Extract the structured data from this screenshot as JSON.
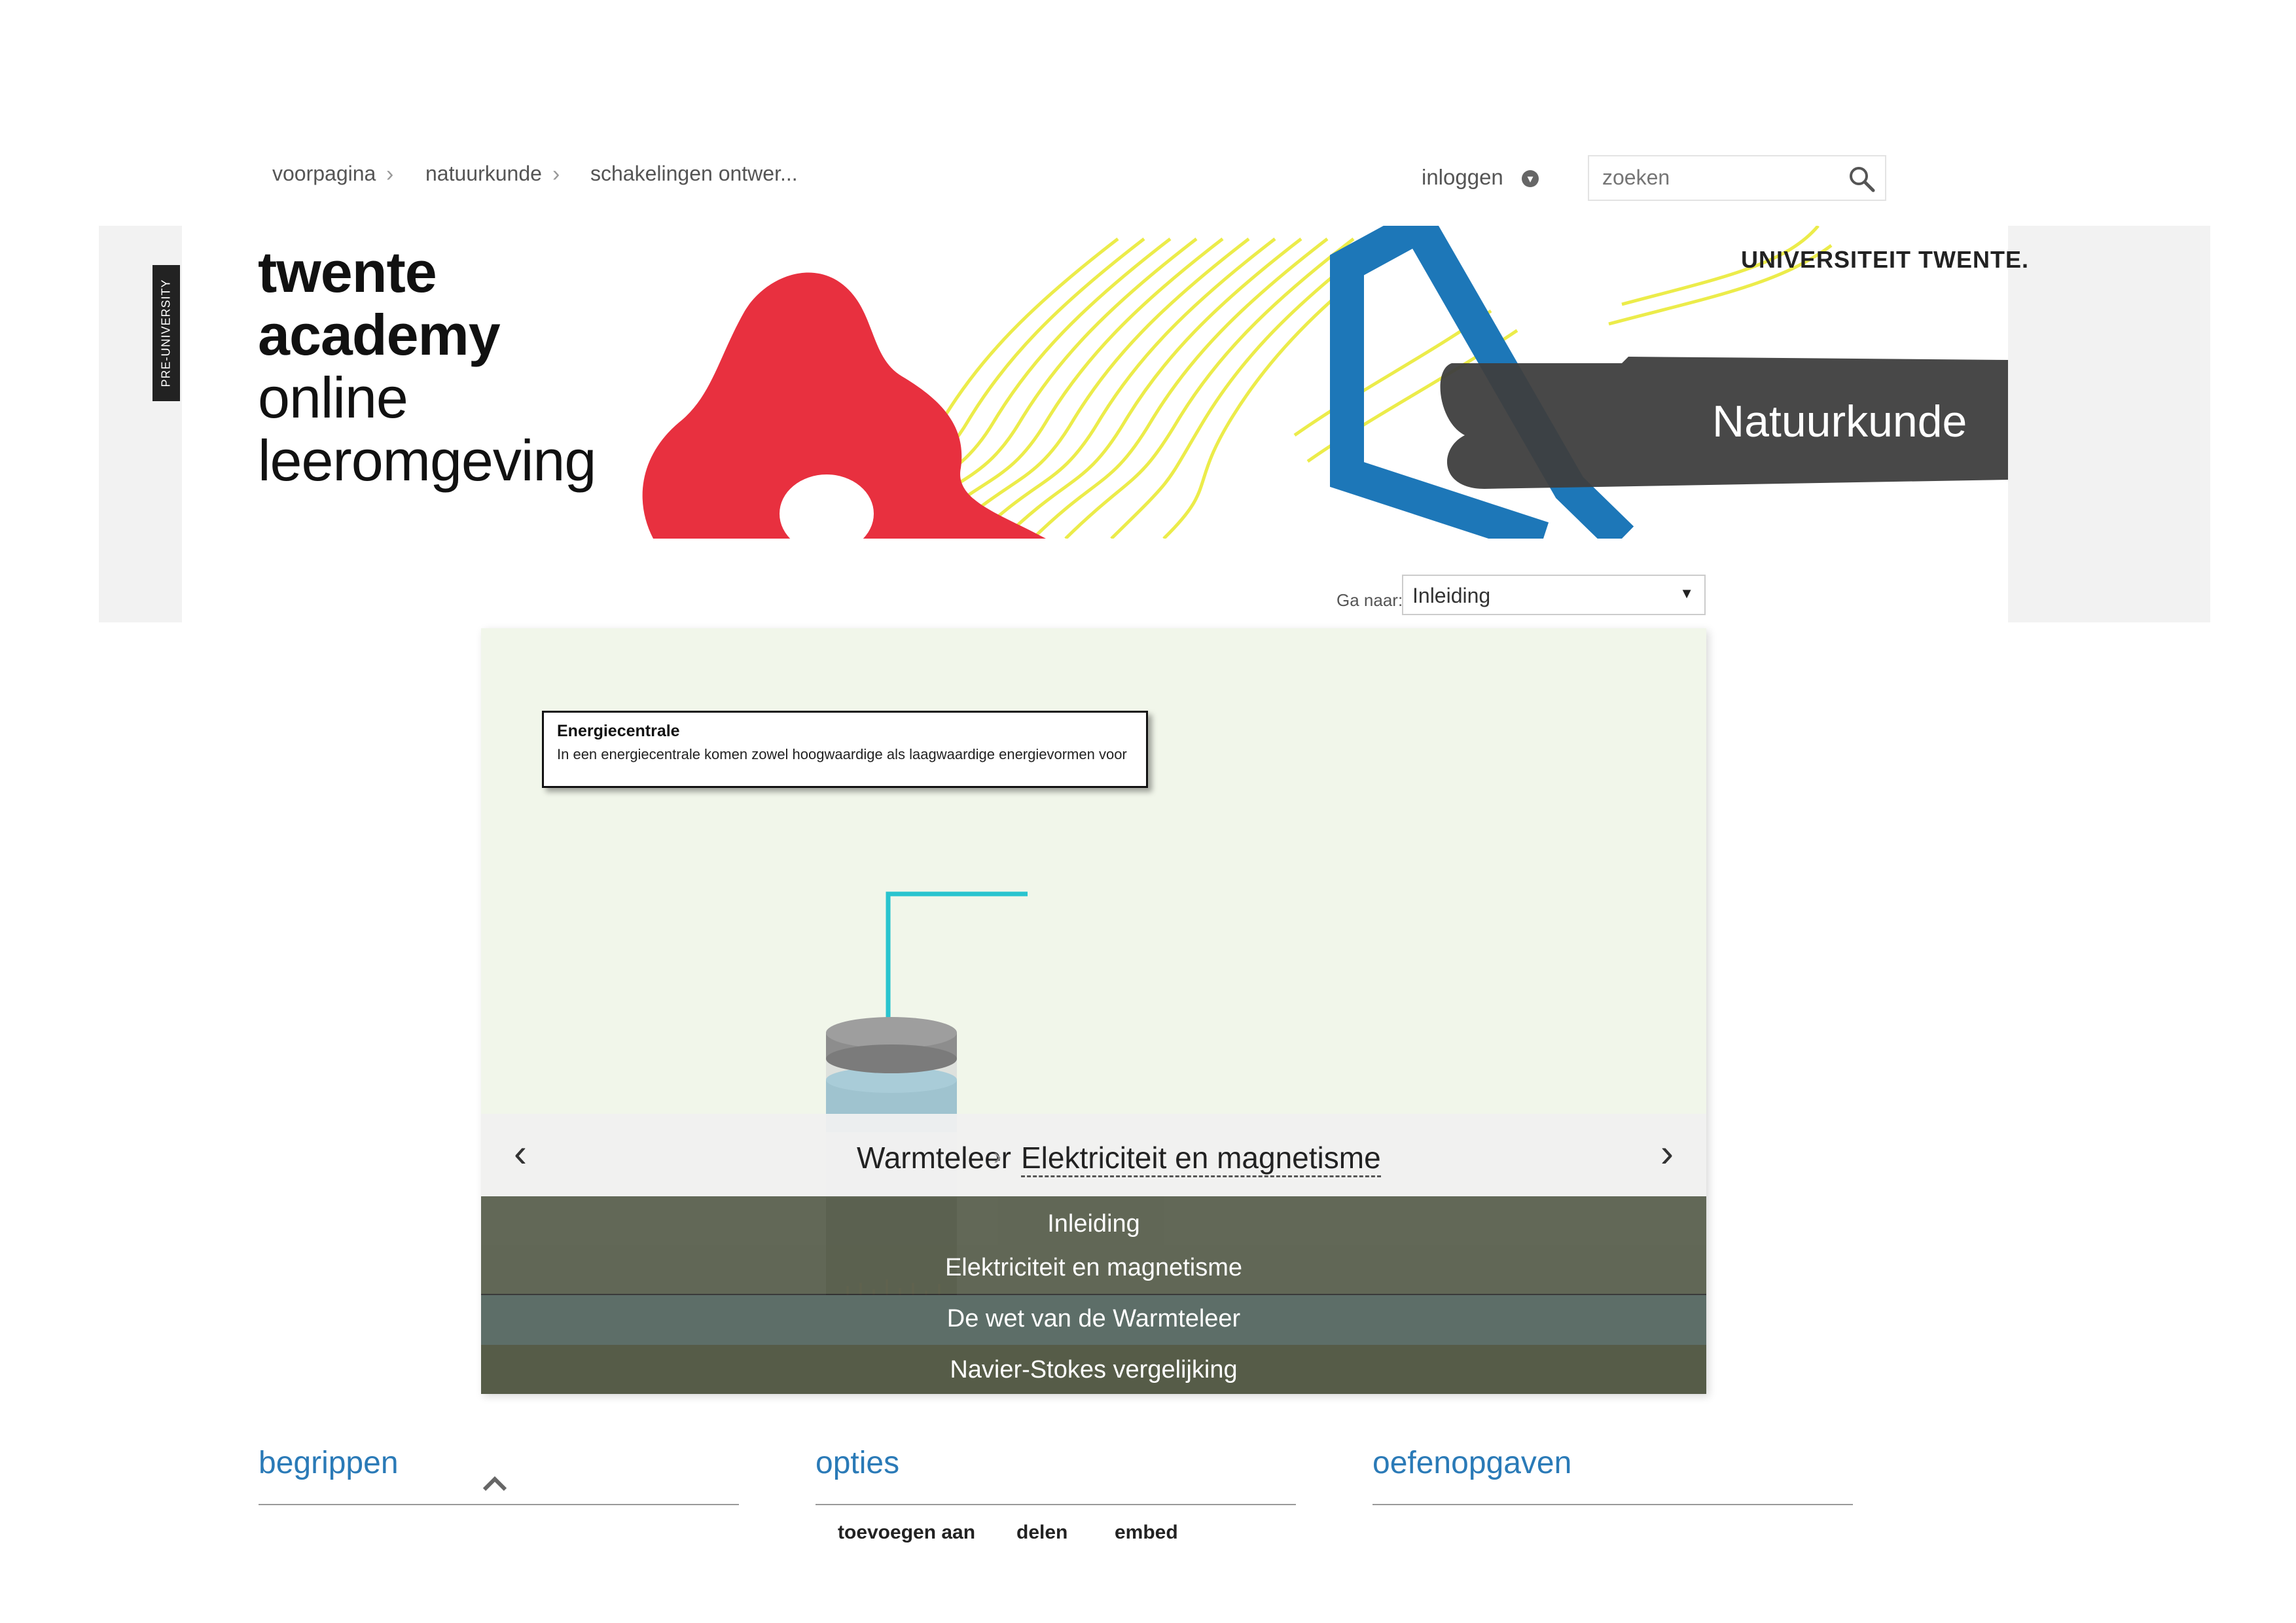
{
  "breadcrumb": {
    "items": [
      "voorpagina",
      "natuurkunde",
      "schakelingen ontwer..."
    ]
  },
  "header": {
    "login_label": "inloggen",
    "search_placeholder": "zoeken"
  },
  "banner": {
    "side_tag": "PRE-UNIVERSITY",
    "brand_line1": "twente",
    "brand_line2": "academy",
    "brand_line3": "online",
    "brand_line4": "leeromgeving",
    "university_logo": "UNIVERSITEIT TWENTE.",
    "subject": "Natuurkunde",
    "colors": {
      "red": "#e8303f",
      "blue": "#1d77b8",
      "yellow": "#ecec4a",
      "dark": "#3e3e3e"
    }
  },
  "goto": {
    "label": "Ga naar:",
    "selected": "Inleiding"
  },
  "viewer": {
    "tooltip_title": "Energiecentrale",
    "tooltip_body": "In een energiecentrale komen zowel hoogwaardige als laagwaardige energievormen voor",
    "nav_crumb1": "Warmteleer",
    "nav_crumb2": "Elektriciteit en magnetisme",
    "menu_items": [
      {
        "label": "Inleiding",
        "color": "#5c6250"
      },
      {
        "label": "Elektriciteit en magnetisme",
        "color": "#5c6250"
      },
      {
        "label": "De wet van de Warmteleer",
        "color": "#5d6e68"
      },
      {
        "label": "Navier-Stokes vergelijking",
        "color": "#565c48"
      }
    ]
  },
  "sections": {
    "begrippen": "begrippen",
    "opties": "opties",
    "oefenopgaven": "oefenopgaven",
    "option_links": [
      "toevoegen aan",
      "delen",
      "embed"
    ],
    "accent_color": "#2a7ab7"
  }
}
